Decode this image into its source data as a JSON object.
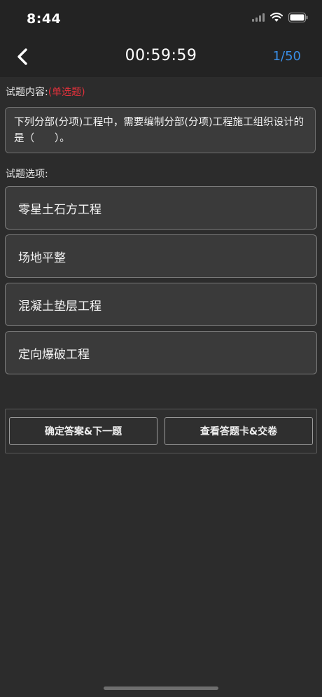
{
  "status_bar": {
    "time": "8:44",
    "icons": [
      "signal-icon",
      "wifi-icon",
      "battery-icon"
    ]
  },
  "nav": {
    "back_icon": "chevron-left-icon",
    "timer": "00:59:59",
    "progress": "1/50",
    "progress_color": "#3a8ee6"
  },
  "question": {
    "label": "试题内容:",
    "type": "(单选题)",
    "type_color": "#e0313b",
    "text": "下列分部(分项)工程中，需要编制分部(分项)工程施工组织设计的是（　　）。"
  },
  "options": {
    "label": "试题选项:",
    "items": [
      {
        "text": "零星土石方工程"
      },
      {
        "text": "场地平整"
      },
      {
        "text": "混凝土垫层工程"
      },
      {
        "text": "定向爆破工程"
      }
    ]
  },
  "actions": {
    "confirm_next": "确定答案&下一题",
    "view_card_submit": "查看答题卡&交卷"
  }
}
